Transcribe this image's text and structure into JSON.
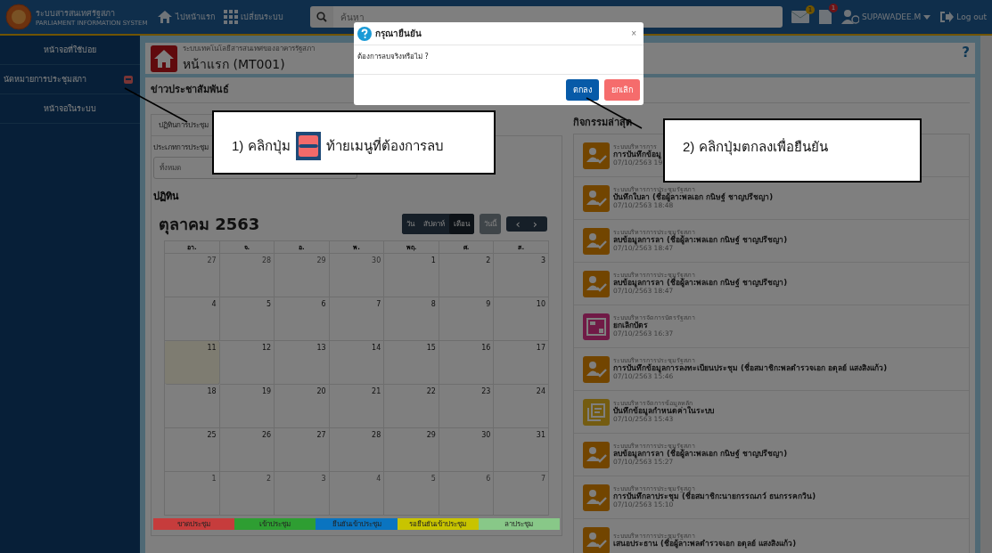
{
  "topbar": {
    "app_name": "ระบบสารสนเทศรัฐสภา",
    "app_subtitle": "PARLIAMENT INFORMATION SYSTEM",
    "home_link": "ไปหน้าแรก",
    "switch_link": "เปลี่ยนระบบ",
    "search": {
      "placeholder": "ค้นหา"
    },
    "mail_badge": "1",
    "doc_badge": "1",
    "user": "SUPAWADEE.M",
    "logout": "Log out"
  },
  "sidebar": {
    "items": [
      {
        "label": "หน้าจอที่ใช้บ่อย",
        "kind": "heading"
      },
      {
        "label": "นัดหมายการประชุมสภา",
        "kind": "removable"
      },
      {
        "label": "หน้าจอในระบบ",
        "kind": "heading"
      }
    ]
  },
  "page_header": {
    "system": "ระบบเทคโนโลยีสารสนเทศของอาคารรัฐสภา",
    "title": "หน้าแรก (MT001)",
    "help": "?"
  },
  "section_title": "ข่าวประชาสัมพันธ์",
  "calendar_panel": {
    "tab": "ปฏิทินการประชุม",
    "filter_label": "ประเภทการประชุม",
    "filter_value": "ทั้งหมด",
    "heading": "ปฏิทิน",
    "month": "ตุลาคม 2563",
    "views": [
      {
        "label": "วัน",
        "selected": false
      },
      {
        "label": "สัปดาห์",
        "selected": false
      },
      {
        "label": "เดือน",
        "selected": true
      }
    ],
    "today_button": "วันนี้",
    "prev": "‹",
    "next": "›",
    "weekdays": [
      "อา.",
      "จ.",
      "อ.",
      "พ.",
      "พฤ.",
      "ศ.",
      "ส."
    ],
    "weeks": [
      [
        {
          "day": "27",
          "other_month": true,
          "today": false
        },
        {
          "day": "28",
          "other_month": true,
          "today": false
        },
        {
          "day": "29",
          "other_month": true,
          "today": false
        },
        {
          "day": "30",
          "other_month": true,
          "today": false
        },
        {
          "day": "1",
          "other_month": false,
          "today": false
        },
        {
          "day": "2",
          "other_month": false,
          "today": false
        },
        {
          "day": "3",
          "other_month": false,
          "today": false
        }
      ],
      [
        {
          "day": "4",
          "other_month": false,
          "today": false
        },
        {
          "day": "5",
          "other_month": false,
          "today": false
        },
        {
          "day": "6",
          "other_month": false,
          "today": false
        },
        {
          "day": "7",
          "other_month": false,
          "today": false
        },
        {
          "day": "8",
          "other_month": false,
          "today": false
        },
        {
          "day": "9",
          "other_month": false,
          "today": false
        },
        {
          "day": "10",
          "other_month": false,
          "today": false
        }
      ],
      [
        {
          "day": "11",
          "other_month": false,
          "today": true
        },
        {
          "day": "12",
          "other_month": false,
          "today": false
        },
        {
          "day": "13",
          "other_month": false,
          "today": false
        },
        {
          "day": "14",
          "other_month": false,
          "today": false
        },
        {
          "day": "15",
          "other_month": false,
          "today": false
        },
        {
          "day": "16",
          "other_month": false,
          "today": false
        },
        {
          "day": "17",
          "other_month": false,
          "today": false
        }
      ],
      [
        {
          "day": "18",
          "other_month": false,
          "today": false
        },
        {
          "day": "19",
          "other_month": false,
          "today": false
        },
        {
          "day": "20",
          "other_month": false,
          "today": false
        },
        {
          "day": "21",
          "other_month": false,
          "today": false
        },
        {
          "day": "22",
          "other_month": false,
          "today": false
        },
        {
          "day": "23",
          "other_month": false,
          "today": false
        },
        {
          "day": "24",
          "other_month": false,
          "today": false
        }
      ],
      [
        {
          "day": "25",
          "other_month": false,
          "today": false
        },
        {
          "day": "26",
          "other_month": false,
          "today": false
        },
        {
          "day": "27",
          "other_month": false,
          "today": false
        },
        {
          "day": "28",
          "other_month": false,
          "today": false
        },
        {
          "day": "29",
          "other_month": false,
          "today": false
        },
        {
          "day": "30",
          "other_month": false,
          "today": false
        },
        {
          "day": "31",
          "other_month": false,
          "today": false
        }
      ],
      [
        {
          "day": "1",
          "other_month": true,
          "today": false
        },
        {
          "day": "2",
          "other_month": true,
          "today": false
        },
        {
          "day": "3",
          "other_month": true,
          "today": false
        },
        {
          "day": "4",
          "other_month": true,
          "today": false
        },
        {
          "day": "5",
          "other_month": true,
          "today": false
        },
        {
          "day": "6",
          "other_month": true,
          "today": false
        },
        {
          "day": "7",
          "other_month": true,
          "today": false
        }
      ]
    ],
    "legend": [
      {
        "label": "ขาดประชุม",
        "color": "#c63c3c"
      },
      {
        "label": "เข้าประชุม",
        "color": "#2e9e32"
      },
      {
        "label": "ยืนยันเข้าประชุม",
        "color": "#0a74c0"
      },
      {
        "label": "รอยืนยันเข้าประชุม",
        "color": "#c8c400"
      },
      {
        "label": "ลาประชุม",
        "color": "#88c888"
      }
    ]
  },
  "activity": {
    "title": "กิจกรรมล่าสุด",
    "items": [
      {
        "kind": "person",
        "system": "ระบบบริหารการ",
        "action": "การบันทึกข้อมู",
        "time": "07/10/2563 19:"
      },
      {
        "kind": "person",
        "system": "ระบบบริหารการประชุมรัฐสภา",
        "action": "บันทึกใบลา (ชื่อผู้ลา:พลเอก กนิษฐ์ ชาญปรีชญา)",
        "time": "07/10/2563 18:48"
      },
      {
        "kind": "person",
        "system": "ระบบบริหารการประชุมรัฐสภา",
        "action": "ลบข้อมูลการลา (ชื่อผู้ลา:พลเอก กนิษฐ์ ชาญปรีชญา)",
        "time": "07/10/2563 18:47"
      },
      {
        "kind": "person",
        "system": "ระบบบริหารการประชุมรัฐสภา",
        "action": "ลบข้อมูลการลา (ชื่อผู้ลา:พลเอก กนิษฐ์ ชาญปรีชญา)",
        "time": "07/10/2563 18:47"
      },
      {
        "kind": "card",
        "system": "ระบบบริหารจัดการบัตรรัฐสภา",
        "action": "ยกเลิกบัตร",
        "time": "07/10/2563 16:37"
      },
      {
        "kind": "person",
        "system": "ระบบบริหารการประชุมรัฐสภา",
        "action": "การบันทึกข้อมูลการลงทะเบียนประชุม (ชื่อสมาชิก:พลตำรวจเอก อดุลย์ แสงสิงแก้ว)",
        "time": "07/10/2563 15:46"
      },
      {
        "kind": "document",
        "system": "ระบบบริหารจัดการข้อมูลหลัก",
        "action": "บันทึกข้อมูลกำหนดค่าในระบบ",
        "time": "07/10/2563 15:43"
      },
      {
        "kind": "person",
        "system": "ระบบบริหารการประชุมรัฐสภา",
        "action": "ลบข้อมูลการลา (ชื่อผู้ลา:พลเอก กนิษฐ์ ชาญปรีชญา)",
        "time": "07/10/2563 15:27"
      },
      {
        "kind": "person",
        "system": "ระบบบริหารการประชุมรัฐสภา",
        "action": "การบันทึกลาประชุม (ชื่อสมาชิก:นายกรรณภว์ ธนกรรคกวิน)",
        "time": "07/10/2563 15:10"
      },
      {
        "kind": "person",
        "system": "ระบบบริหารการประชุมรัฐสภา",
        "action": "เสนอประธาน (ชื่อผู้ลา:พลตำรวจเอก อดุลย์ แสงสิงแก้ว)"
      }
    ]
  },
  "dialog": {
    "title": "กรุณายืนยัน",
    "close": "×",
    "message": "ต้องการลบจริงหรือไม่ ?",
    "buttons": [
      {
        "label": "ตกลง",
        "kind": "primary"
      },
      {
        "label": "ยกเลิก",
        "kind": "cancel"
      }
    ]
  },
  "annotations": [
    {
      "before": "1) คลิกปุ่ม",
      "after": "ท้ายเมนูที่ต้องการลบ"
    },
    {
      "before": "2) คลิกปุ่มตกลงเพื่อยืนยัน"
    }
  ]
}
